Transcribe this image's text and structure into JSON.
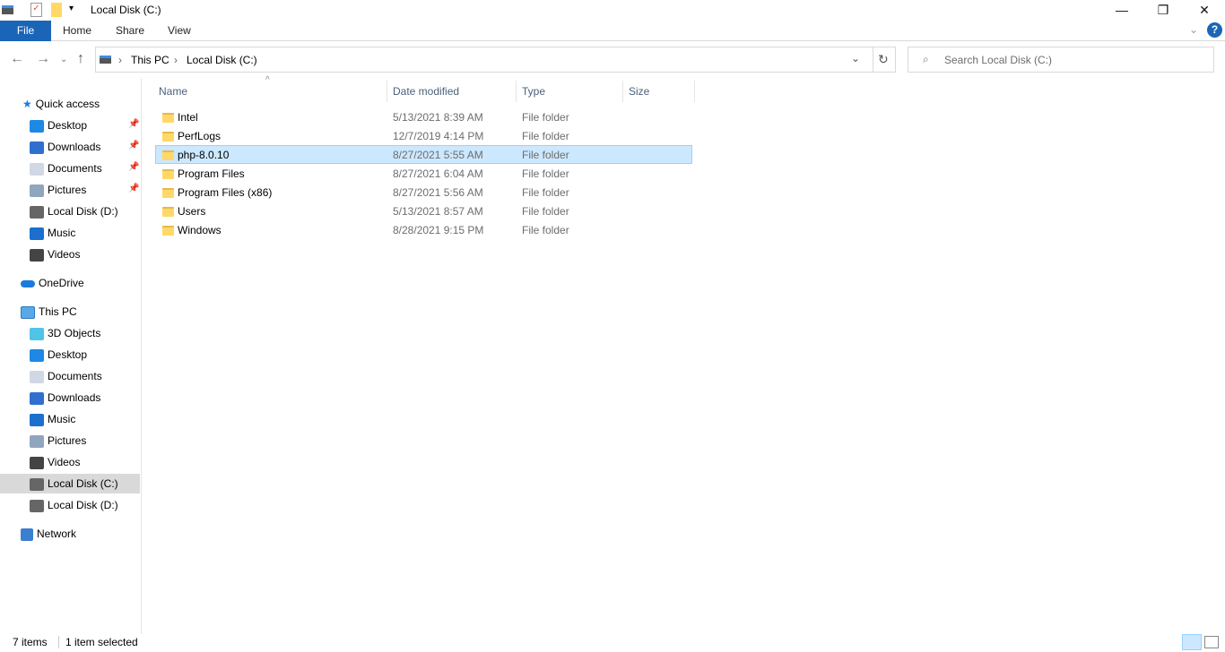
{
  "window": {
    "title": "Local Disk (C:)",
    "minimize": "—",
    "restore": "❐",
    "close": "✕"
  },
  "ribbon": {
    "tabs": [
      "File",
      "Home",
      "Share",
      "View"
    ],
    "help": "?",
    "expand": "⌄"
  },
  "address": {
    "crumbs": [
      "This PC",
      "Local Disk (C:)"
    ],
    "search_placeholder": "Search Local Disk (C:)"
  },
  "sidebar": {
    "quick_access": "Quick access",
    "quick_items": [
      {
        "label": "Desktop",
        "icon": "desktop",
        "pinned": true
      },
      {
        "label": "Downloads",
        "icon": "download",
        "pinned": true
      },
      {
        "label": "Documents",
        "icon": "document",
        "pinned": true
      },
      {
        "label": "Pictures",
        "icon": "picture",
        "pinned": true
      },
      {
        "label": "Local Disk (D:)",
        "icon": "drive"
      },
      {
        "label": "Music",
        "icon": "music"
      },
      {
        "label": "Videos",
        "icon": "video"
      }
    ],
    "onedrive": "OneDrive",
    "this_pc": "This PC",
    "pc_items": [
      {
        "label": "3D Objects",
        "icon": "cube"
      },
      {
        "label": "Desktop",
        "icon": "desktop"
      },
      {
        "label": "Documents",
        "icon": "document"
      },
      {
        "label": "Downloads",
        "icon": "download"
      },
      {
        "label": "Music",
        "icon": "music"
      },
      {
        "label": "Pictures",
        "icon": "picture"
      },
      {
        "label": "Videos",
        "icon": "video"
      },
      {
        "label": "Local Disk (C:)",
        "icon": "drive",
        "selected": true
      },
      {
        "label": "Local Disk (D:)",
        "icon": "drive"
      }
    ],
    "network": "Network"
  },
  "columns": [
    "Name",
    "Date modified",
    "Type",
    "Size"
  ],
  "files": [
    {
      "name": "Intel",
      "date": "5/13/2021 8:39 AM",
      "type": "File folder"
    },
    {
      "name": "PerfLogs",
      "date": "12/7/2019 4:14 PM",
      "type": "File folder"
    },
    {
      "name": "php-8.0.10",
      "date": "8/27/2021 5:55 AM",
      "type": "File folder",
      "selected": true
    },
    {
      "name": "Program Files",
      "date": "8/27/2021 6:04 AM",
      "type": "File folder"
    },
    {
      "name": "Program Files (x86)",
      "date": "8/27/2021 5:56 AM",
      "type": "File folder"
    },
    {
      "name": "Users",
      "date": "5/13/2021 8:57 AM",
      "type": "File folder"
    },
    {
      "name": "Windows",
      "date": "8/28/2021 9:15 PM",
      "type": "File folder"
    }
  ],
  "status": {
    "count": "7 items",
    "selected": "1 item selected"
  }
}
